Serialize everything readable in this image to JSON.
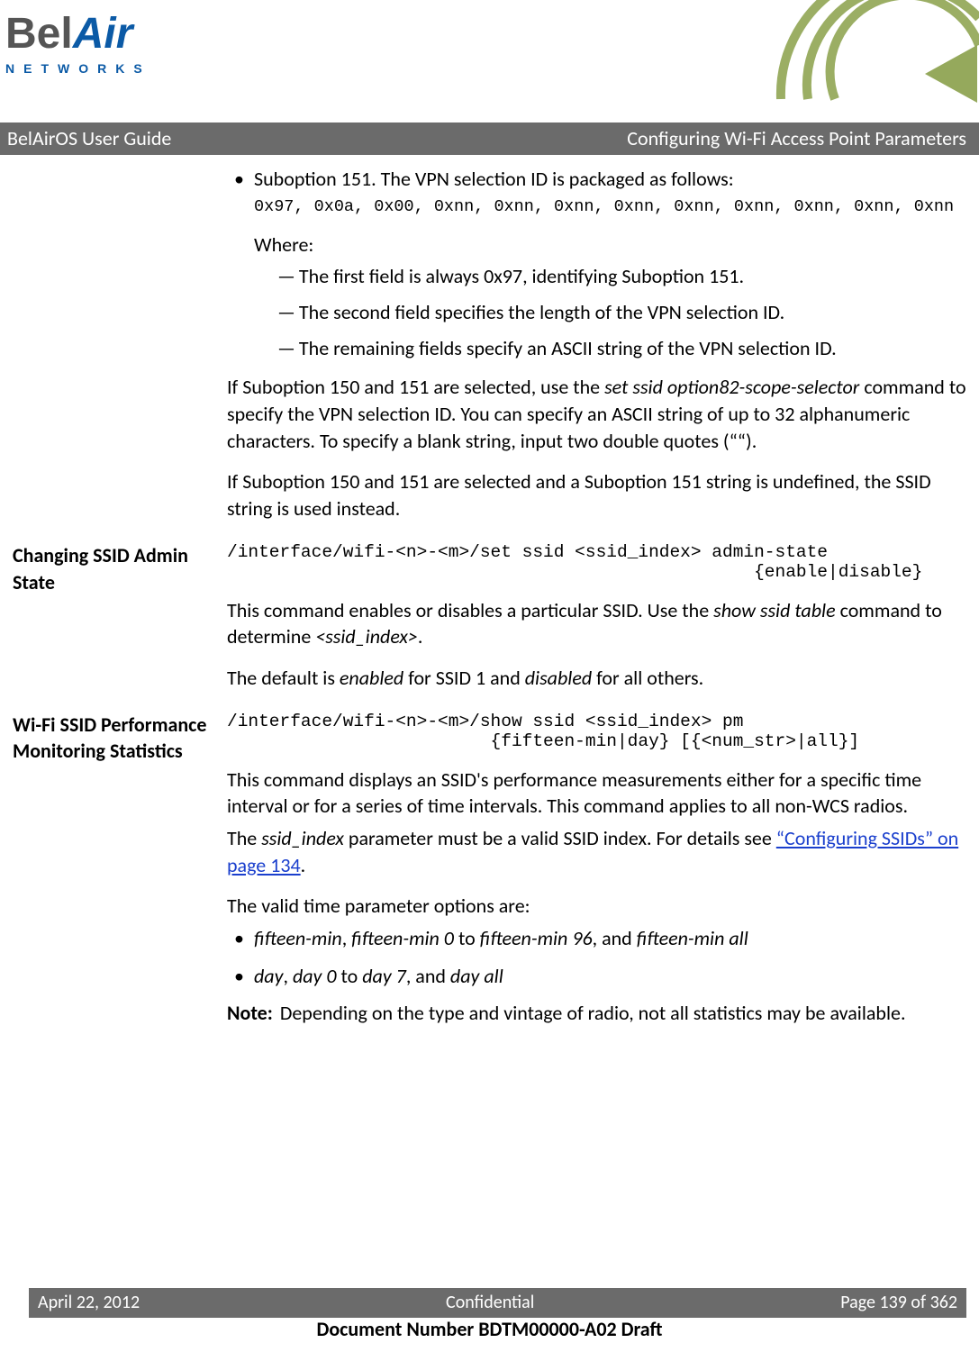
{
  "logo": {
    "bel": "Bel",
    "air": "Air",
    "networks": "NETWORKS"
  },
  "headerBar": {
    "left": "BelAirOS User Guide",
    "right": "Configuring Wi-Fi Access Point Parameters"
  },
  "section1": {
    "bullet1": "Suboption 151. The VPN selection ID is packaged as follows:",
    "packagedCode": "0x97, 0x0a, 0x00, 0xnn, 0xnn, 0xnn, 0xnn, 0xnn, 0xnn, 0xnn, 0xnn, 0xnn",
    "whereLabel": "Where:",
    "dash1": "The first field is always 0x97, identifying Suboption 151.",
    "dash2": "The second field specifies the length of the VPN selection ID.",
    "dash3": "The remaining fields specify an ASCII string of the VPN selection ID.",
    "p1a": "If Suboption 150 and 151 are selected, use the ",
    "p1cmd": "set ssid option82-scope-selector",
    "p1b": " command to specify the VPN selection ID. You can specify an ASCII string of up to 32 alphanumeric characters. To specify a blank string, input two double quotes (““).",
    "p2": "If Suboption 150 and 151 are selected and a Suboption 151 string is undefined, the SSID string is used instead."
  },
  "section2": {
    "heading": "Changing SSID Admin State",
    "code1": "/interface/wifi-<n>-<m>/set ssid <ssid_index> admin-state",
    "code2": "                                                  {enable|disable}",
    "p1a": "This command enables or disables a particular SSID. Use the ",
    "p1cmd": "show ssid table",
    "p1b": " command to determine ",
    "p1arg": "<ssid_index>",
    "p1c": ".",
    "p2a": "The default is ",
    "p2en": "enabled",
    "p2b": " for SSID 1 and ",
    "p2dis": "disabled",
    "p2c": " for all others."
  },
  "section3": {
    "heading": "Wi-Fi SSID Performance Monitoring Statistics",
    "code1": "/interface/wifi-<n>-<m>/show ssid <ssid_index> pm",
    "code2": "                         {fifteen-min|day} [{<num_str>|all}]",
    "p1": "This command displays an SSID's performance measurements either for a specific time interval or for a series of time intervals. This command applies to all non-WCS radios.",
    "p2a": "The ",
    "p2arg": "ssid_index",
    "p2b": " parameter must be a valid SSID index. For details see ",
    "p2link": "“Configuring SSIDs” on page 134",
    "p2c": ".",
    "p3": "The valid time parameter options are:",
    "opt1": {
      "a": "fifteen-min",
      "b": ", ",
      "c": "fifteen-min 0",
      "d": " to ",
      "e": "fifteen-min 96",
      "f": ", and ",
      "g": "fifteen-min all"
    },
    "opt2": {
      "a": "day",
      "b": ", ",
      "c": "day 0",
      "d": " to ",
      "e": "day 7",
      "f": ", and ",
      "g": "day all"
    },
    "noteLabel": "Note:",
    "noteText": "Depending on the type and vintage of radio, not all statistics may be available."
  },
  "footer": {
    "left": "April 22, 2012",
    "center": "Confidential",
    "right": "Page 139 of 362",
    "docnum": "Document Number BDTM00000-A02 Draft"
  }
}
